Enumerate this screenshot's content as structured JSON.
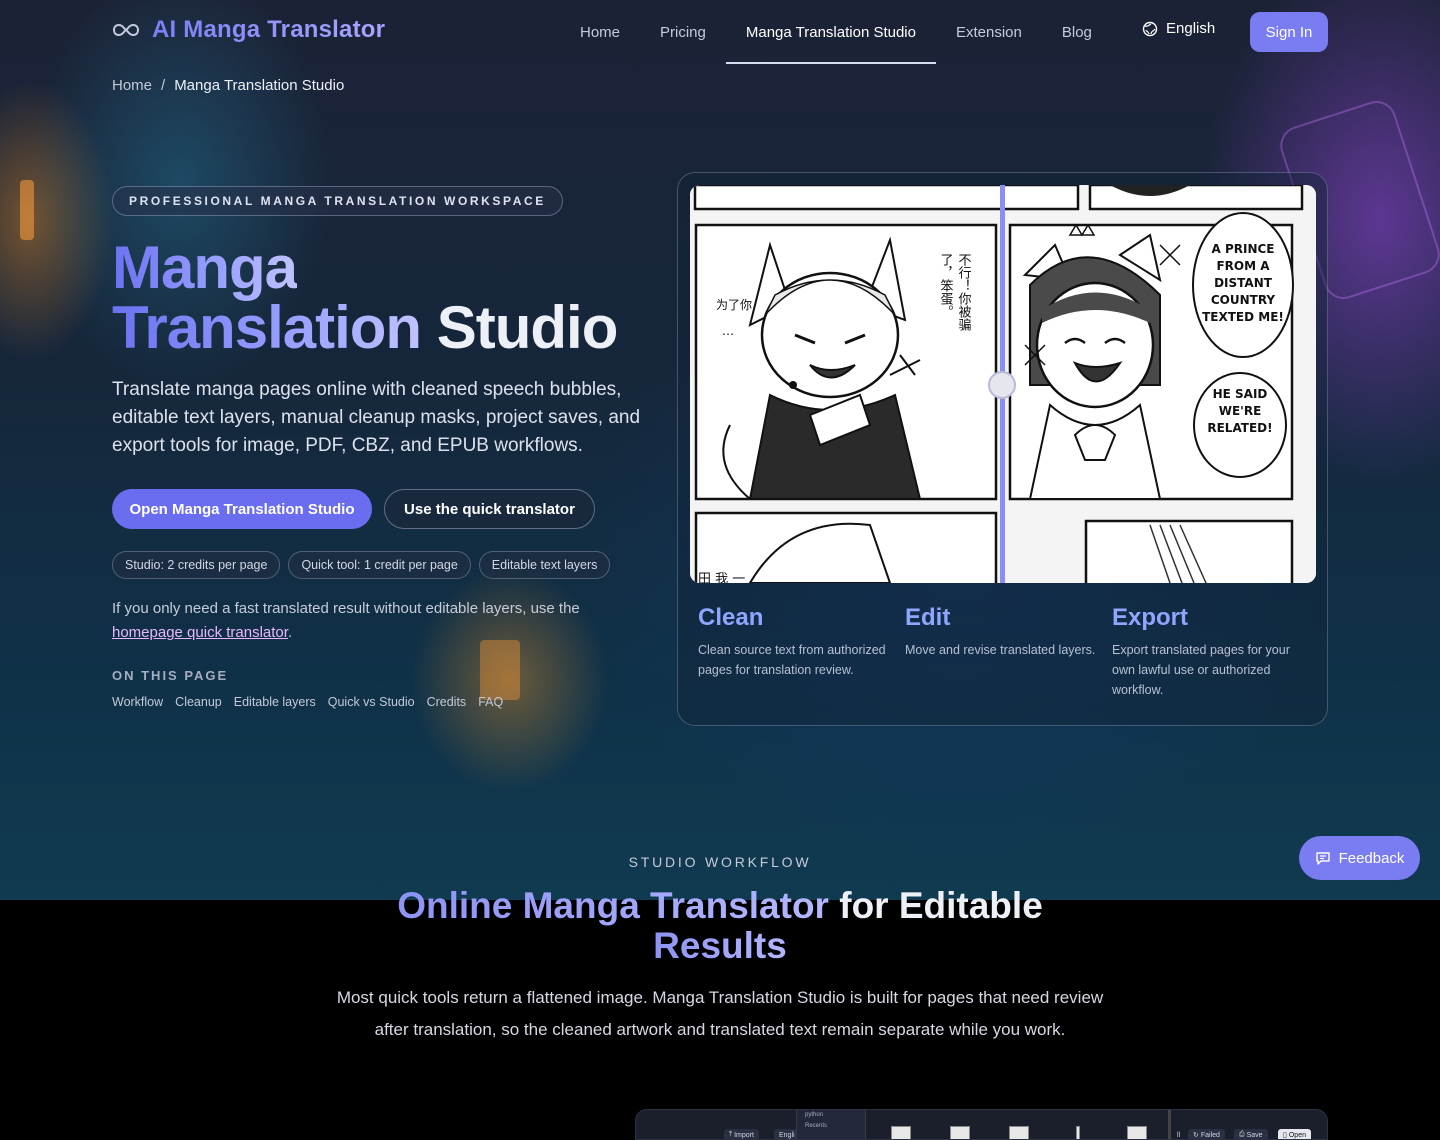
{
  "brand": {
    "name": "AI Manga Translator",
    "logo": "infinity-icon"
  },
  "nav": {
    "items": [
      {
        "label": "Home",
        "active": false
      },
      {
        "label": "Pricing",
        "active": false
      },
      {
        "label": "Manga Translation Studio",
        "active": true
      },
      {
        "label": "Extension",
        "active": false
      },
      {
        "label": "Blog",
        "active": false
      }
    ],
    "language": "English",
    "sign_in": "Sign In"
  },
  "breadcrumb": {
    "home": "Home",
    "separator": "/",
    "current": "Manga Translation Studio"
  },
  "hero": {
    "eyebrow": "PROFESSIONAL MANGA TRANSLATION WORKSPACE",
    "title_gradient_1": "Manga",
    "title_gradient_2": "Translation",
    "title_plain": "Studio",
    "description": "Translate manga pages online with cleaned speech bubbles, editable text layers, manual cleanup masks, project saves, and export tools for image, PDF, CBZ, and EPUB workflows.",
    "primary_button": "Open Manga Translation Studio",
    "secondary_button": "Use the quick translator",
    "pills": [
      "Studio: 2 credits per page",
      "Quick tool: 1 credit per page",
      "Editable text layers"
    ],
    "note_prefix": "If you only need a fast translated result without editable layers, use the",
    "note_link": "homepage quick translator",
    "note_suffix": ".",
    "toc_title": "ON THIS PAGE",
    "toc": [
      "Workflow",
      "Cleanup",
      "Editable layers",
      "Quick vs Studio",
      "Credits",
      "FAQ"
    ]
  },
  "preview": {
    "manga_text": {
      "cn_vertical_1": "不行！你被骗",
      "cn_vertical_2": "了，笨蛋。",
      "cn_small": "为了你",
      "cn_dots": "…",
      "cn_bottom": "田 我 一",
      "en_bubble_1": [
        "A PRINCE",
        "FROM A",
        "DISTANT",
        "COUNTRY",
        "TEXTED ME!"
      ],
      "en_bubble_2": [
        "HE SAID",
        "WE'RE",
        "RELATED!"
      ]
    },
    "features": [
      {
        "title": "Clean",
        "text": "Clean source text from authorized pages for translation review."
      },
      {
        "title": "Edit",
        "text": "Move and revise translated layers."
      },
      {
        "title": "Export",
        "text": "Export translated pages for your own lawful use or authorized workflow."
      }
    ]
  },
  "feedback": {
    "label": "Feedback",
    "icon": "chat-icon"
  },
  "workflow": {
    "eyebrow": "STUDIO WORKFLOW",
    "title_gradient": "Online Manga Translator",
    "title_plain_1": "for Editable",
    "title_plain_2": "Results",
    "description": "Most quick tools return a flattened image. Manga Translation Studio is built for pages that need review after translation, so the cleaned artwork and translated text remain separate while you work."
  },
  "studio_preview": {
    "import": "Import",
    "lang": "Engli",
    "sidebar": [
      "python",
      "Recents"
    ],
    "failed": "Failed",
    "save": "Save",
    "open": "Open",
    "all": "ll"
  },
  "colors": {
    "accent": "#7a7cf2",
    "primary_button": "#6b6df0",
    "feature_title": "#8fa6ff",
    "link": "#e9b6ff"
  }
}
